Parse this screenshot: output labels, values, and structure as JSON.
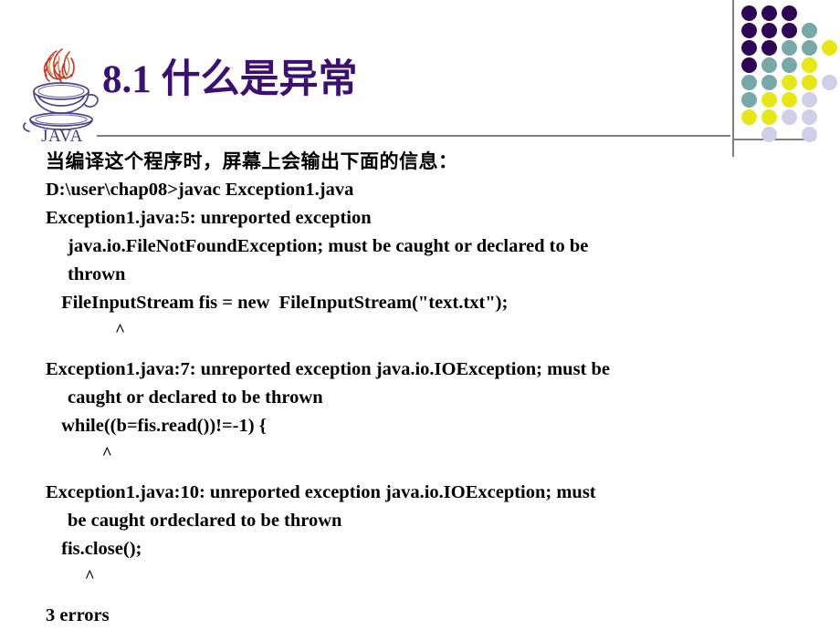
{
  "slide": {
    "title": "8.1 什么是异常",
    "title_color": "#3B1070",
    "background": "#ffffff",
    "logo_label": "JAVA",
    "rule_color": "#808080"
  },
  "decoration": {
    "name": "dot-grid",
    "colors": {
      "purple": "#2E0854",
      "teal": "#78A8A8",
      "yellow": "#E6E619",
      "lavender": "#CFCFE8"
    },
    "grid": [
      [
        "purple",
        "purple",
        "purple",
        "",
        ""
      ],
      [
        "purple",
        "purple",
        "purple",
        "teal",
        ""
      ],
      [
        "purple",
        "purple",
        "teal",
        "teal",
        "yellow"
      ],
      [
        "purple",
        "teal",
        "teal",
        "yellow",
        ""
      ],
      [
        "teal",
        "teal",
        "yellow",
        "yellow",
        "lavender"
      ],
      [
        "teal",
        "yellow",
        "yellow",
        "lavender",
        ""
      ],
      [
        "yellow",
        "yellow",
        "lavender",
        "lavender",
        ""
      ],
      [
        "",
        "lavender",
        "",
        "lavender",
        ""
      ]
    ]
  },
  "content": {
    "lines": [
      {
        "text": "当编译这个程序时，屏幕上会输出下面的信息：",
        "style": "cjk"
      },
      {
        "text": "D:\\user\\chap08>javac Exception1.java",
        "style": "plain"
      },
      {
        "text": "Exception1.java:5: unreported exception",
        "style": "plain"
      },
      {
        "text": "java.io.FileNotFoundException; must be caught or declared to be",
        "style": "ind1"
      },
      {
        "text": "thrown",
        "style": "ind1"
      },
      {
        "text": " FileInputStream fis = new  FileInputStream(\"text.txt\");",
        "style": "ind2"
      },
      {
        "text": "                ^",
        "style": "caret"
      },
      {
        "text": "",
        "style": "gap"
      },
      {
        "text": "Exception1.java:7: unreported exception java.io.IOException; must be",
        "style": "plain"
      },
      {
        "text": "caught or declared to be thrown",
        "style": "ind1"
      },
      {
        "text": " while((b=fis.read())!=-1) {",
        "style": "ind2"
      },
      {
        "text": "             ^",
        "style": "caret"
      },
      {
        "text": "",
        "style": "gap"
      },
      {
        "text": "Exception1.java:10: unreported exception java.io.IOException; must",
        "style": "plain"
      },
      {
        "text": "be caught ordeclared to be thrown",
        "style": "ind1"
      },
      {
        "text": " fis.close();",
        "style": "ind2"
      },
      {
        "text": "         ^",
        "style": "caret"
      },
      {
        "text": "",
        "style": "gap"
      },
      {
        "text": "3 errors",
        "style": "plain"
      }
    ]
  }
}
